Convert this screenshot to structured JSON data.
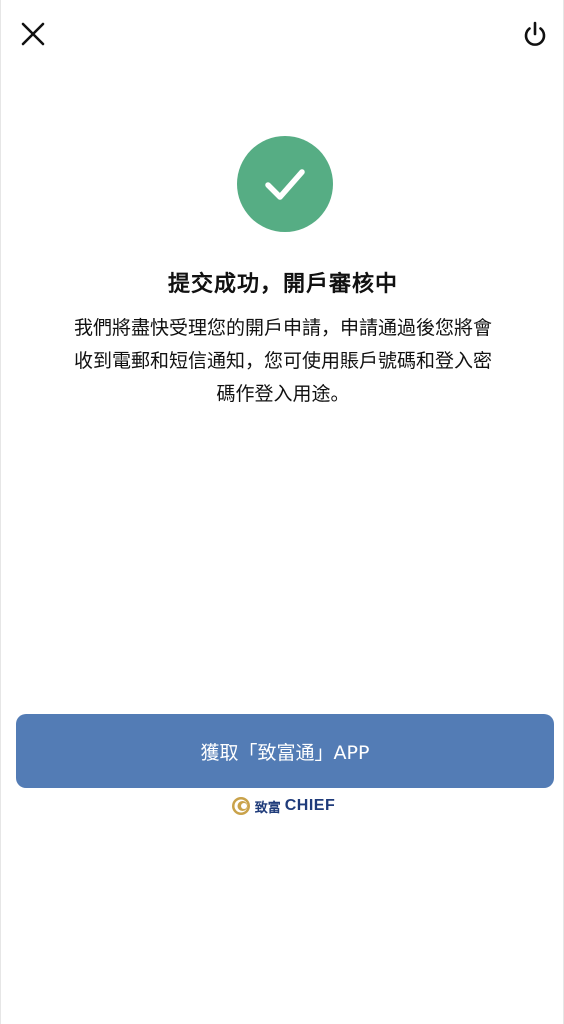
{
  "success": {
    "title": "提交成功，開戶審核中",
    "message": "我們將盡快受理您的開戶申請，申請通過後您將會收到電郵和短信通知，您可使用賬戶號碼和登入密碼作登入用途。"
  },
  "actions": {
    "get_app_label": "獲取「致富通」APP"
  },
  "brand": {
    "cn": "致富",
    "en": "CHIEF"
  },
  "colors": {
    "success_green": "#56ad84",
    "button_blue": "#537cb5",
    "brand_navy": "#1f3b7a",
    "brand_gold": "#c9a24a"
  },
  "icons": {
    "close": "close-icon",
    "power": "power-icon",
    "check": "check-icon",
    "logo": "chief-logo-icon"
  }
}
